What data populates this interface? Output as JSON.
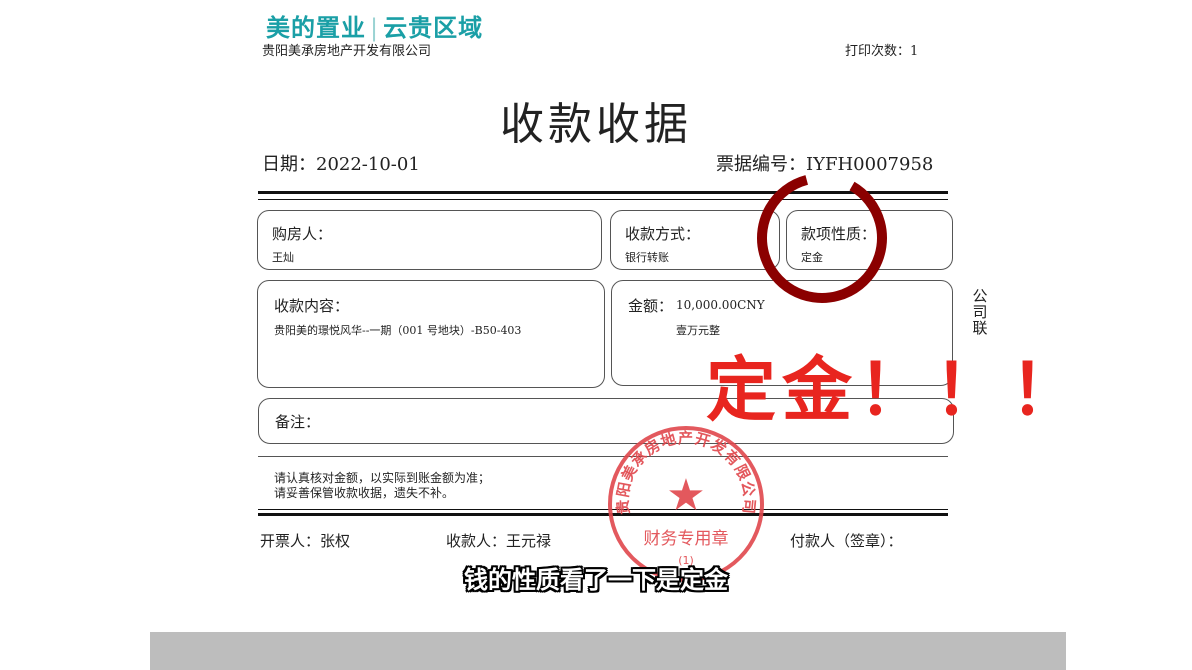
{
  "colors": {
    "brand": "#1a9fa6",
    "red": "#e8251f",
    "stamp": "#e0474c",
    "circle": "#8b0000"
  },
  "header": {
    "logo_left": "美的置业",
    "logo_sep": "|",
    "logo_right": "云贵区域",
    "company": "贵阳美承房地产开发有限公司",
    "print_count": "打印次数：1"
  },
  "title": "收款收据",
  "meta": {
    "date": "日期：2022-10-01",
    "receipt_no": "票据编号：IYFH0007958"
  },
  "fields": {
    "buyer_label": "购房人：",
    "buyer_value": "王灿",
    "pay_method_label": "收款方式：",
    "pay_method_value": "银行转账",
    "nature_label": "款项性质：",
    "nature_value": "定金",
    "content_label": "收款内容：",
    "content_value": "贵阳美的璟悦风华--一期（001 号地块）-B50-403",
    "amount_label": "金额：",
    "amount_value": "10,000.00CNY",
    "amount_words": "壹万元整",
    "remark_label": "备注："
  },
  "side_label": "公司联",
  "notes": [
    "请认真核对金额，以实际到账金额为准；",
    "请妥善保管收款收据，遗失不补。"
  ],
  "signers": {
    "issuer": "开票人：张权",
    "receiver": "收款人：王元禄",
    "payer": "付款人（签章）："
  },
  "stamp": {
    "ring_text": "贵阳美承房地产开发有限公司",
    "center_text": "财务专用章",
    "bottom_text": "(1)",
    "star": "★"
  },
  "overlay_text": "定金！！！",
  "subtitle": "钱的性质看了一下是定金"
}
